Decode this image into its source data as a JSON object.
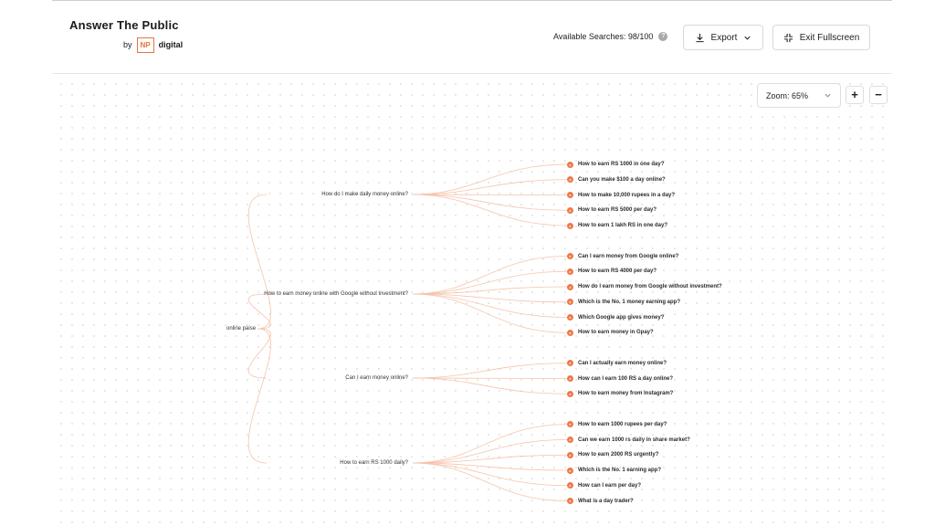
{
  "header": {
    "logo_title": "Answer The Public",
    "logo_by": "by",
    "logo_np": "NP",
    "logo_digital": "digital",
    "available_searches": "Available Searches: 98/100",
    "export_label": "Export",
    "exit_fullscreen_label": "Exit Fullscreen"
  },
  "toolbar": {
    "zoom_label": "Zoom: 65%",
    "zoom_in": "+",
    "zoom_out": "−"
  },
  "tree": {
    "root": "online paise",
    "accent_color": "#ee7a48",
    "branches": [
      {
        "label": "How do I make daily money online?",
        "questions": [
          "How to earn RS 1000 in one day?",
          "Can you make $100 a day online?",
          "How to make 10,000 rupees in a day?",
          "How to earn RS 5000 per day?",
          "How to earn 1 lakh RS in one day?"
        ]
      },
      {
        "label": "How to earn money online with Google without investment?",
        "questions": [
          "Can I earn money from Google online?",
          "How to earn RS 4000 per day?",
          "How do I earn money from Google without investment?",
          "Which is the No. 1 money earning app?",
          "Which Google app gives money?",
          "How to earn money in Gpay?"
        ]
      },
      {
        "label": "Can I earn money online?",
        "questions": [
          "Can I actually earn money online?",
          "How can I earn 100 RS a day online?",
          "How to earn money from Instagram?"
        ]
      },
      {
        "label": "How to earn RS 1000 daily?",
        "questions": [
          "How to earn 1000 rupees per day?",
          "Can we earn 1000 rs daily in share market?",
          "How to earn 2000 RS urgently?",
          "Which is the No. 1 earning app?",
          "How can I earn per day?",
          "What is a day trader?"
        ]
      }
    ]
  }
}
